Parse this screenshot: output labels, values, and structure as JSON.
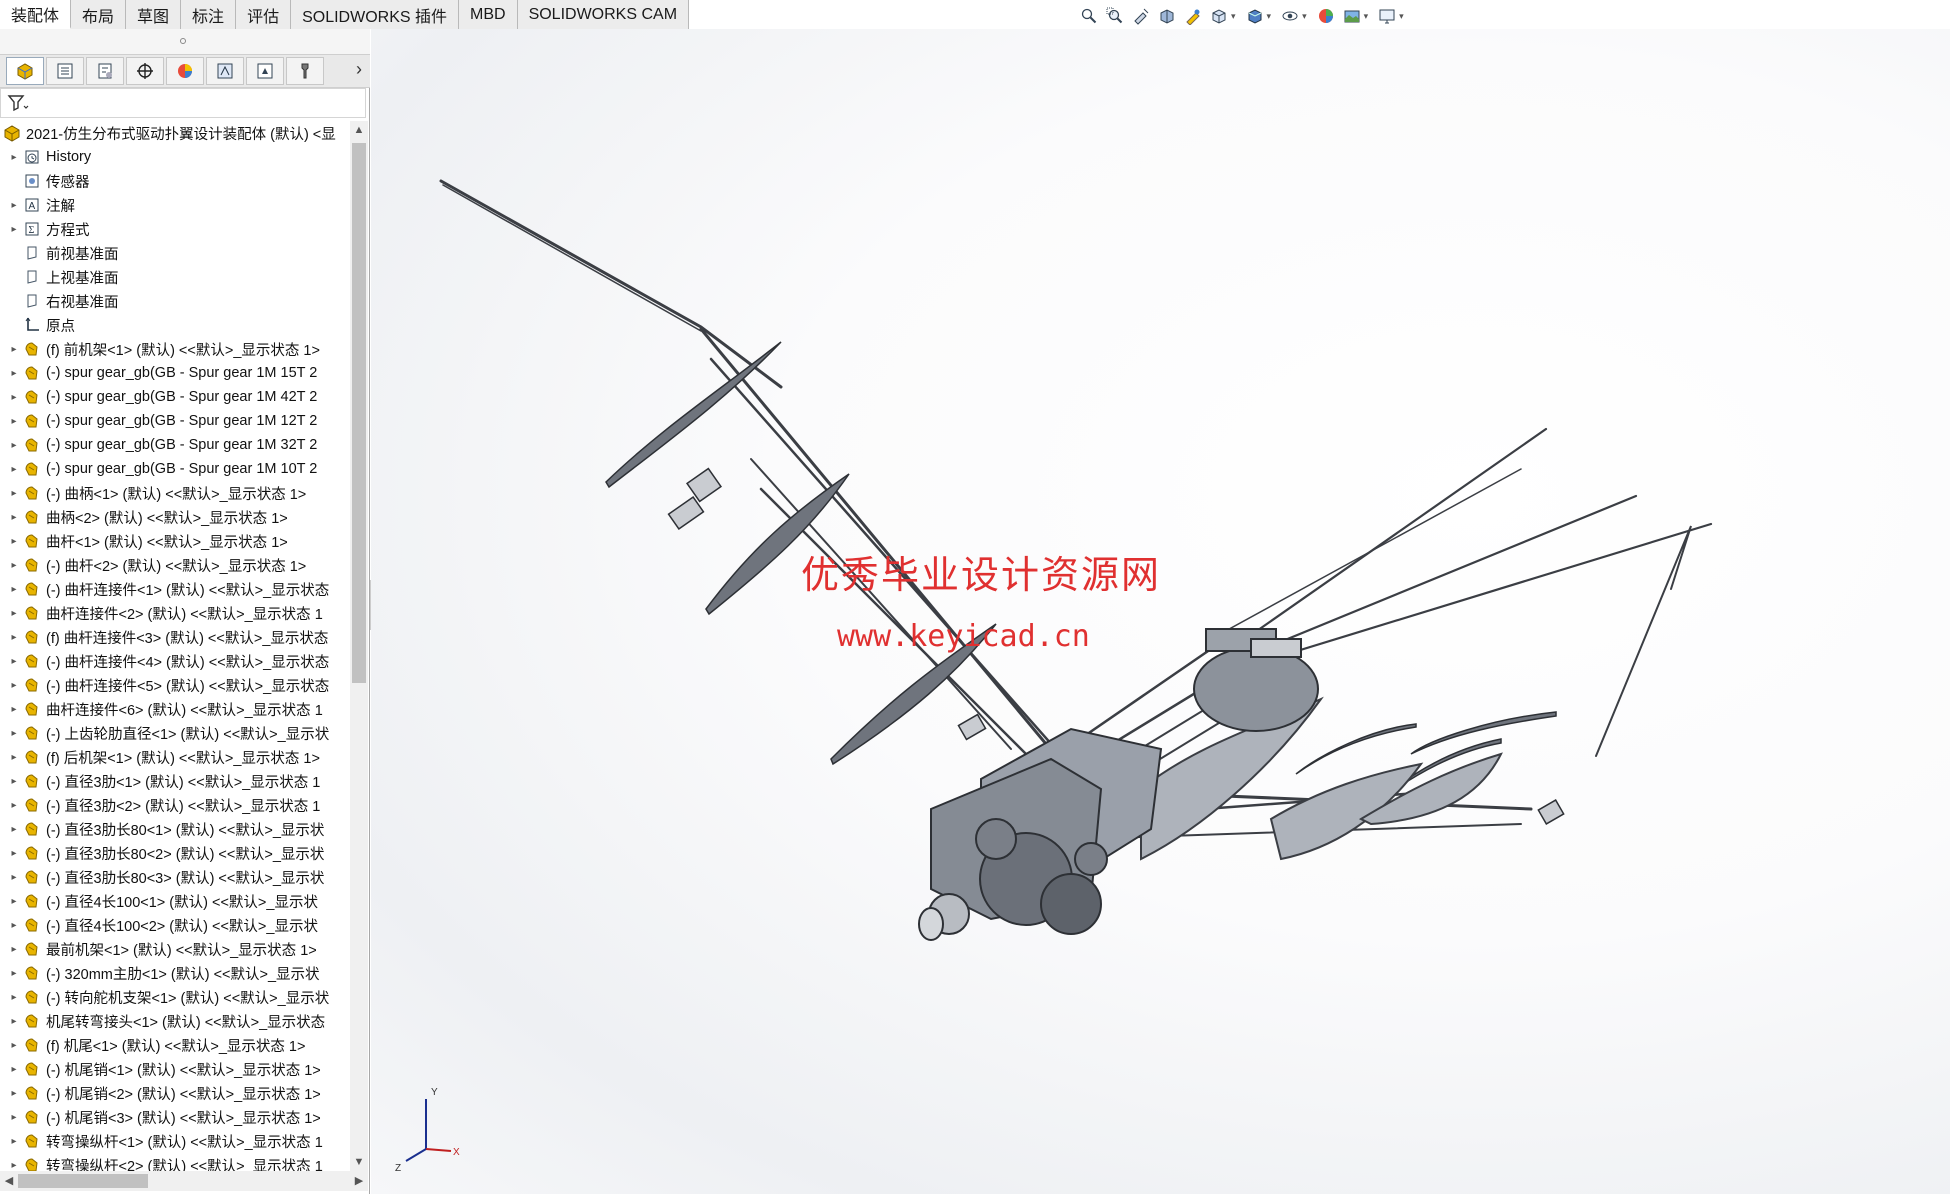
{
  "tabs": [
    {
      "label": "装配体",
      "active": true
    },
    {
      "label": "布局"
    },
    {
      "label": "草图"
    },
    {
      "label": "标注"
    },
    {
      "label": "评估"
    },
    {
      "label": "SOLIDWORKS 插件"
    },
    {
      "label": "MBD"
    },
    {
      "label": "SOLIDWORKS CAM"
    }
  ],
  "heads_up_toolbar": [
    "zoom-to-fit-icon",
    "zoom-to-area-icon",
    "previous-view-icon",
    "section-view-icon",
    "dynamic-annotation-icon",
    "view-orientation-icon",
    "display-style-icon",
    "hide-show-icon",
    "edit-appearance-icon",
    "apply-scene-icon",
    "view-settings-icon"
  ],
  "feature_manager": {
    "tabs": [
      "featuremanager-icon",
      "propertymanager-icon",
      "configurationmanager-icon",
      "dimxpert-icon",
      "display-manager-icon",
      "cam-feature-icon",
      "cam-operation-icon",
      "cam-tool-icon"
    ],
    "root": "2021-仿生分布式驱动扑翼设计装配体 (默认) <显",
    "items": [
      {
        "label": "History",
        "icon": "history-icon",
        "expander": true
      },
      {
        "label": "传感器",
        "icon": "sensor-icon",
        "expander": false
      },
      {
        "label": "注解",
        "icon": "annotation-icon",
        "expander": true
      },
      {
        "label": "方程式",
        "icon": "equation-icon",
        "expander": true
      },
      {
        "label": "前视基准面",
        "icon": "plane-icon",
        "expander": false
      },
      {
        "label": "上视基准面",
        "icon": "plane-icon",
        "expander": false
      },
      {
        "label": "右视基准面",
        "icon": "plane-icon",
        "expander": false
      },
      {
        "label": "原点",
        "icon": "origin-icon",
        "expander": false
      },
      {
        "label": "(f) 前机架<1> (默认) <<默认>_显示状态 1>",
        "icon": "part-icon",
        "expander": true
      },
      {
        "label": "(-) spur gear_gb(GB - Spur gear 1M 15T 2",
        "icon": "part-icon",
        "expander": true
      },
      {
        "label": "(-) spur gear_gb(GB - Spur gear 1M 42T 2",
        "icon": "part-icon",
        "expander": true
      },
      {
        "label": "(-) spur gear_gb(GB - Spur gear 1M 12T 2",
        "icon": "part-icon",
        "expander": true
      },
      {
        "label": "(-) spur gear_gb(GB - Spur gear 1M 32T 2",
        "icon": "part-icon",
        "expander": true
      },
      {
        "label": "(-) spur gear_gb(GB - Spur gear 1M 10T 2",
        "icon": "part-icon",
        "expander": true
      },
      {
        "label": "(-) 曲柄<1> (默认) <<默认>_显示状态 1>",
        "icon": "part-icon",
        "expander": true
      },
      {
        "label": "曲柄<2> (默认) <<默认>_显示状态 1>",
        "icon": "part-icon",
        "expander": true
      },
      {
        "label": "曲杆<1> (默认) <<默认>_显示状态 1>",
        "icon": "part-icon",
        "expander": true
      },
      {
        "label": "(-) 曲杆<2> (默认) <<默认>_显示状态 1>",
        "icon": "part-icon",
        "expander": true
      },
      {
        "label": "(-) 曲杆连接件<1> (默认) <<默认>_显示状态",
        "icon": "part-icon",
        "expander": true
      },
      {
        "label": "曲杆连接件<2> (默认) <<默认>_显示状态 1",
        "icon": "part-icon",
        "expander": true
      },
      {
        "label": "(f) 曲杆连接件<3> (默认) <<默认>_显示状态",
        "icon": "part-icon",
        "expander": true
      },
      {
        "label": "(-) 曲杆连接件<4> (默认) <<默认>_显示状态",
        "icon": "part-icon",
        "expander": true
      },
      {
        "label": "(-) 曲杆连接件<5> (默认) <<默认>_显示状态",
        "icon": "part-icon",
        "expander": true
      },
      {
        "label": "曲杆连接件<6> (默认) <<默认>_显示状态 1",
        "icon": "part-icon",
        "expander": true
      },
      {
        "label": "(-) 上齿轮肋直径<1> (默认) <<默认>_显示状",
        "icon": "part-icon",
        "expander": true
      },
      {
        "label": "(f) 后机架<1> (默认) <<默认>_显示状态 1>",
        "icon": "part-icon",
        "expander": true
      },
      {
        "label": "(-) 直径3肋<1> (默认) <<默认>_显示状态 1",
        "icon": "part-icon",
        "expander": true
      },
      {
        "label": "(-) 直径3肋<2> (默认) <<默认>_显示状态 1",
        "icon": "part-icon",
        "expander": true
      },
      {
        "label": "(-) 直径3肋长80<1> (默认) <<默认>_显示状",
        "icon": "part-icon",
        "expander": true
      },
      {
        "label": "(-) 直径3肋长80<2> (默认) <<默认>_显示状",
        "icon": "part-icon",
        "expander": true
      },
      {
        "label": "(-) 直径3肋长80<3> (默认) <<默认>_显示状",
        "icon": "part-icon",
        "expander": true
      },
      {
        "label": "(-) 直径4长100<1> (默认) <<默认>_显示状",
        "icon": "part-icon",
        "expander": true
      },
      {
        "label": "(-) 直径4长100<2> (默认) <<默认>_显示状",
        "icon": "part-icon",
        "expander": true
      },
      {
        "label": "最前机架<1> (默认) <<默认>_显示状态 1>",
        "icon": "part-icon",
        "expander": true
      },
      {
        "label": "(-) 320mm主肋<1> (默认) <<默认>_显示状",
        "icon": "part-icon",
        "expander": true
      },
      {
        "label": "(-) 转向舵机支架<1> (默认) <<默认>_显示状",
        "icon": "part-icon",
        "expander": true
      },
      {
        "label": "机尾转弯接头<1> (默认) <<默认>_显示状态",
        "icon": "part-icon",
        "expander": true
      },
      {
        "label": "(f) 机尾<1> (默认) <<默认>_显示状态 1>",
        "icon": "part-icon",
        "expander": true
      },
      {
        "label": "(-) 机尾销<1> (默认) <<默认>_显示状态 1>",
        "icon": "part-icon",
        "expander": true
      },
      {
        "label": "(-) 机尾销<2> (默认) <<默认>_显示状态 1>",
        "icon": "part-icon",
        "expander": true
      },
      {
        "label": "(-) 机尾销<3> (默认) <<默认>_显示状态 1>",
        "icon": "part-icon",
        "expander": true
      },
      {
        "label": "转弯操纵杆<1> (默认) <<默认>_显示状态 1",
        "icon": "part-icon",
        "expander": true
      },
      {
        "label": "转弯操纵杆<2> (默认) <<默认>_显示状态 1",
        "icon": "part-icon",
        "expander": true
      }
    ]
  },
  "watermark": {
    "line1": "优秀毕业设计资源网",
    "line2": "www.keyicad.cn"
  },
  "triad": {
    "x": "X",
    "y": "Y",
    "z": "Z"
  },
  "colors": {
    "part_icon": "#e8b400",
    "watermark": "#e03030",
    "model_stroke": "#3b3e44",
    "model_fill": "#9aa0aa"
  }
}
